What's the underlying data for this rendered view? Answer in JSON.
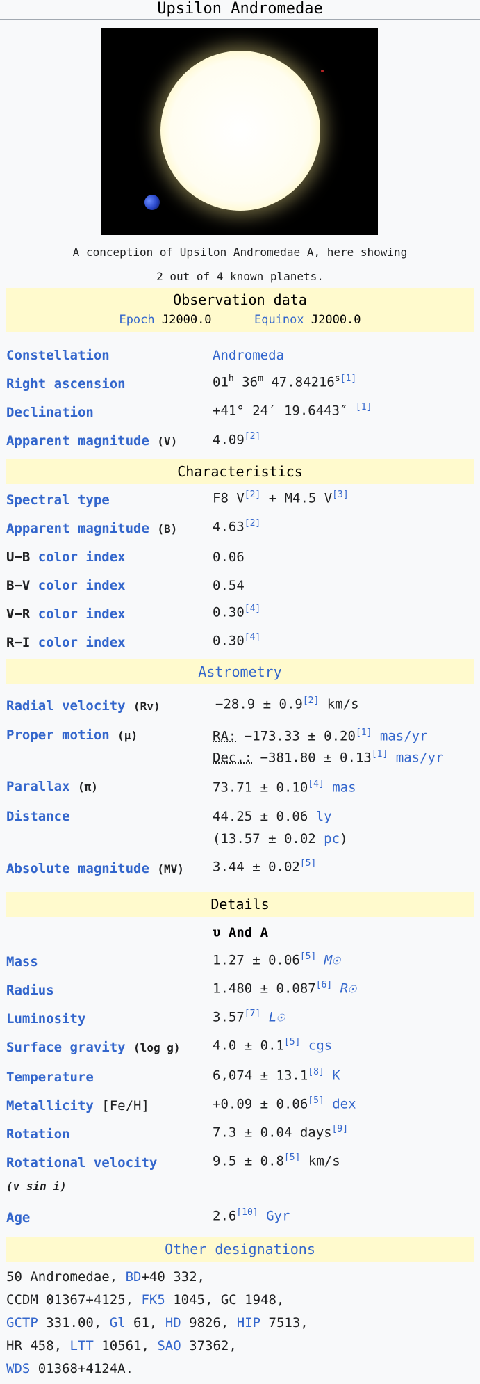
{
  "title": "Upsilon Andromedae",
  "caption_line1": "A conception of Upsilon Andromedae A, here showing",
  "caption_line2": "2 out of 4 known planets.",
  "obs": {
    "header": "Observation data",
    "epoch_label": "Epoch",
    "epoch_value": "J2000.0",
    "equinox_label": "Equinox",
    "equinox_value": "J2000.0"
  },
  "constellation": {
    "label": "Constellation",
    "value": "Andromeda"
  },
  "ra": {
    "label": "Right ascension",
    "h": "01",
    "m": "36",
    "s": "47.84216",
    "ref": "[1]"
  },
  "dec": {
    "label": "Declination",
    "value": "+41° 24′ 19.6443″",
    "ref": "[1]"
  },
  "appmag_v": {
    "label": "Apparent magnitude",
    "band": "(V)",
    "value": "4.09",
    "ref": "[2]"
  },
  "char": {
    "header": "Characteristics"
  },
  "spectral": {
    "label": "Spectral type",
    "v1": "F8 V",
    "ref1": "[2]",
    "v2": " + M4.5 V",
    "ref2": "[3]"
  },
  "appmag_b": {
    "label": "Apparent magnitude",
    "band": "(B)",
    "value": "4.63",
    "ref": "[2]"
  },
  "ub": {
    "label_a": "U−B",
    "label_b": "color index",
    "value": "0.06"
  },
  "bv": {
    "label_a": "B−V",
    "label_b": "color index",
    "value": "0.54"
  },
  "vr": {
    "label_a": "V−R",
    "label_b": "color index",
    "value": "0.30",
    "ref": "[4]"
  },
  "ri": {
    "label_a": "R−I",
    "label_b": "color index",
    "value": "0.30",
    "ref": "[4]"
  },
  "astro": {
    "header": "Astrometry"
  },
  "rv": {
    "label": "Radial velocity",
    "sym": "(Rv)",
    "value": "−28.9 ± 0.9",
    "ref": "[2]",
    "unit": "km/s"
  },
  "pm": {
    "label": "Proper motion",
    "sym": "(μ)",
    "ra_label": "RA:",
    "ra_value": "−173.33 ± 0.20",
    "ra_ref": "[1]",
    "ra_unit": "mas/yr",
    "dec_label": "Dec.:",
    "dec_value": "−381.80 ± 0.13",
    "dec_ref": "[1]",
    "dec_unit": "mas/yr"
  },
  "parallax": {
    "label": "Parallax",
    "sym": "(π)",
    "value": "73.71 ± 0.10",
    "ref": "[4]",
    "unit": "mas"
  },
  "distance": {
    "label": "Distance",
    "v1": "44.25 ± 0.06",
    "u1": "ly",
    "v2a": "(13.57 ± 0.02",
    "u2": "pc",
    "v2b": ")"
  },
  "absmag": {
    "label": "Absolute magnitude",
    "sym": "(MV)",
    "value": "3.44 ± 0.02",
    "ref": "[5]"
  },
  "details": {
    "header": "Details",
    "sub": "υ And A"
  },
  "mass": {
    "label": "Mass",
    "value": "1.27 ± 0.06",
    "ref": "[5]",
    "unit": "M☉"
  },
  "radius": {
    "label": "Radius",
    "value": "1.480 ± 0.087",
    "ref": "[6]",
    "unit": "R☉"
  },
  "lum": {
    "label": "Luminosity",
    "value": "3.57",
    "ref": "[7]",
    "unit": "L☉"
  },
  "grav": {
    "label": "Surface gravity",
    "sym": "(log g)",
    "value": "4.0 ± 0.1",
    "ref": "[5]",
    "unit": "cgs"
  },
  "temp": {
    "label": "Temperature",
    "value": "6,074 ± 13.1",
    "ref": "[8]",
    "unit": "K"
  },
  "metal": {
    "label": "Metallicity",
    "sym": "[Fe/H]",
    "value": "+0.09 ± 0.06",
    "ref": "[5]",
    "unit": "dex"
  },
  "rot": {
    "label": "Rotation",
    "value": "7.3 ± 0.04 days",
    "ref": "[9]"
  },
  "rotvel": {
    "label": "Rotational velocity",
    "sym": "(v sin i)",
    "value": "9.5 ± 0.8",
    "ref": "[5]",
    "unit": "km/s"
  },
  "age": {
    "label": "Age",
    "value": "2.6",
    "ref": "[10]",
    "unit": "Gyr"
  },
  "other": {
    "header": "Other designations"
  },
  "desig": {
    "t1": "50 Andromedae, ",
    "bd": "BD",
    "t2": "+40 332,",
    "t3": "CCDM 01367+4125, ",
    "fk5": "FK5",
    "t4": " 1045, GC 1948,",
    "gctp": "GCTP",
    "t5": " 331.00, ",
    "gl": "Gl",
    "t6": " 61, ",
    "hd": "HD",
    "t7": " 9826, ",
    "hip": "HIP",
    "t8": " 7513,",
    "t9": "HR 458, ",
    "ltt": "LTT",
    "t10": " 10561, ",
    "sao": "SAO",
    "t11": " 37362,",
    "wds": "WDS",
    "t12": " 01368+4124A."
  }
}
